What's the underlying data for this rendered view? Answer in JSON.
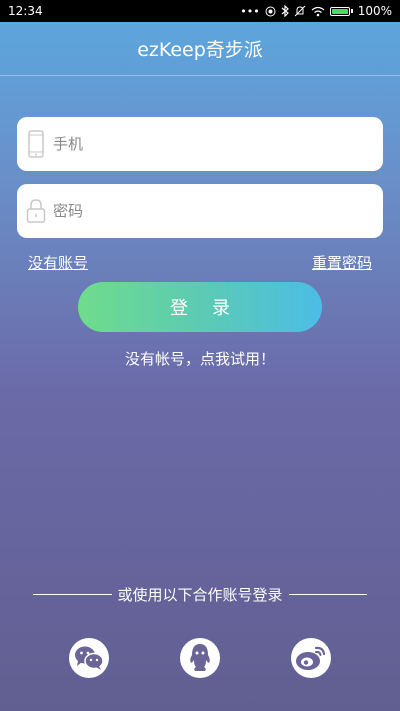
{
  "status_bar": {
    "time": "12:34",
    "battery_level": "100%",
    "icons": [
      "more-dots-icon",
      "circle-icon",
      "bluetooth-icon",
      "mute-icon",
      "wifi-icon",
      "battery-icon"
    ]
  },
  "header": {
    "title": "ezKeep奇步派"
  },
  "login_form": {
    "phone_placeholder": "手机",
    "password_placeholder": "密码",
    "register_link": "没有账号",
    "reset_link": "重置密码",
    "login_button": "登录",
    "trial_text": "没有帐号，点我试用！"
  },
  "third_party": {
    "label": "或使用以下合作账号登录",
    "providers": [
      "wechat-icon",
      "qq-icon",
      "weibo-icon"
    ]
  },
  "colors": {
    "gradient_top": "#5aa9e0",
    "gradient_bottom": "#615f91",
    "button_left": "#6fdc8c",
    "button_right": "#4cbde6",
    "battery_green": "#4cd964"
  }
}
